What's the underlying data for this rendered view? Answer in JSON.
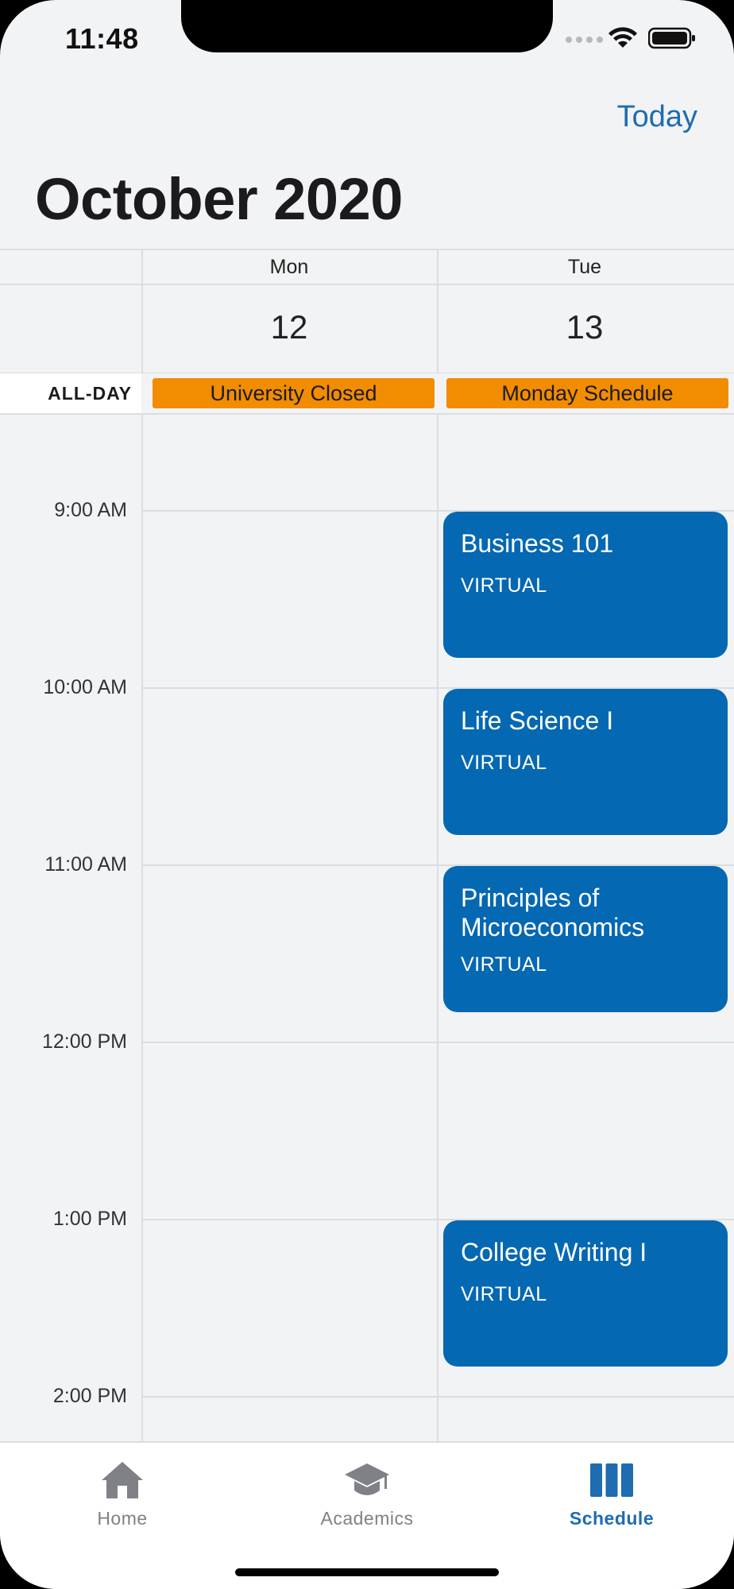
{
  "status_bar": {
    "time": "11:48"
  },
  "header": {
    "today_label": "Today",
    "month_title": "October 2020"
  },
  "days": [
    {
      "name": "Mon",
      "number": "12"
    },
    {
      "name": "Tue",
      "number": "13"
    }
  ],
  "all_day": {
    "label": "ALL-DAY",
    "events": [
      {
        "day": "Mon",
        "title": "University Closed"
      },
      {
        "day": "Tue",
        "title": "Monday Schedule"
      }
    ],
    "event_color": "#f28c00"
  },
  "time_labels": [
    "9:00 AM",
    "10:00 AM",
    "11:00 AM",
    "12:00 PM",
    "1:00 PM",
    "2:00 PM"
  ],
  "events": [
    {
      "day": "Tue",
      "title": "Business 101",
      "location": "VIRTUAL"
    },
    {
      "day": "Tue",
      "title": "Life Science I",
      "location": "VIRTUAL"
    },
    {
      "day": "Tue",
      "title": "Principles of Microeconomics",
      "location": "VIRTUAL"
    },
    {
      "day": "Tue",
      "title": "College Writing I",
      "location": "VIRTUAL"
    }
  ],
  "event_color": "#0568b2",
  "accent_color": "#1f6cb0",
  "tabbar": {
    "tabs": [
      {
        "label": "Home",
        "icon": "home-icon",
        "active": false
      },
      {
        "label": "Academics",
        "icon": "graduation-cap-icon",
        "active": false
      },
      {
        "label": "Schedule",
        "icon": "schedule-columns-icon",
        "active": true
      }
    ]
  }
}
